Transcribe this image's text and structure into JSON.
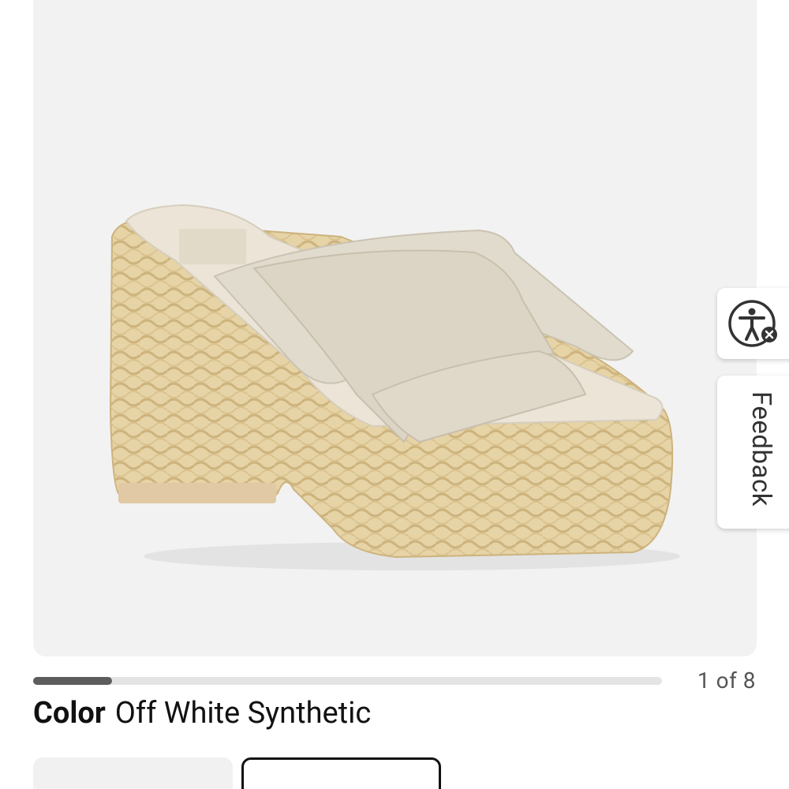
{
  "gallery": {
    "image_alt": "Off white slide sandal with crossover straps on woven raffia platform",
    "pager_text": "1 of 8",
    "progress_fraction": 0.125
  },
  "product": {
    "color_label": "Color",
    "color_value": "Off White Synthetic"
  },
  "side_widgets": {
    "accessibility_icon": "accessibility-icon",
    "feedback_label": "Feedback"
  },
  "colors": {
    "image_bg": "#f2f2f2",
    "progress_fill": "#5d5d5d",
    "progress_track": "#e4e4e4",
    "text_primary": "#111111"
  }
}
